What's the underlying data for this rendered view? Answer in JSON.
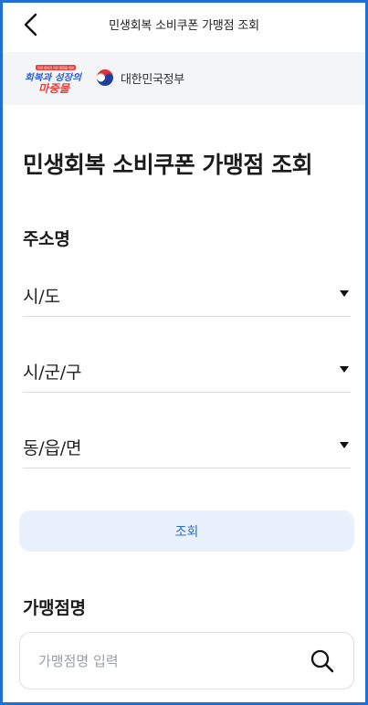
{
  "header": {
    "back_icon": "chevron-left-icon",
    "title": "민생회복 소비쿠폰 가맹점 조회"
  },
  "logos": {
    "campaign": {
      "small_caption": "민생 회복과 국민 통합을 위한",
      "line1": "회복과 성장의",
      "line2": "마중물",
      "color_primary": "#e8413d",
      "color_accent": "#2e5bd7"
    },
    "government": {
      "emblem_icon": "taegeuk-emblem-icon",
      "name": "대한민국정부"
    }
  },
  "page": {
    "title": "민생회복 소비쿠폰 가맹점 조회"
  },
  "address_section": {
    "label": "주소명",
    "selects": [
      {
        "value": "시/도"
      },
      {
        "value": "시/군/구"
      },
      {
        "value": "동/읍/면"
      }
    ]
  },
  "search_button": {
    "label": "조회"
  },
  "store_section": {
    "label": "가맹점명",
    "input_value": "",
    "input_placeholder": "가맹점명 입력",
    "search_icon": "search-icon"
  },
  "colors": {
    "frame_border": "#1f6fd6",
    "logo_strip_bg": "#f4f5f7",
    "button_bg": "#e9f1fc",
    "button_text": "#2c6bd3"
  }
}
